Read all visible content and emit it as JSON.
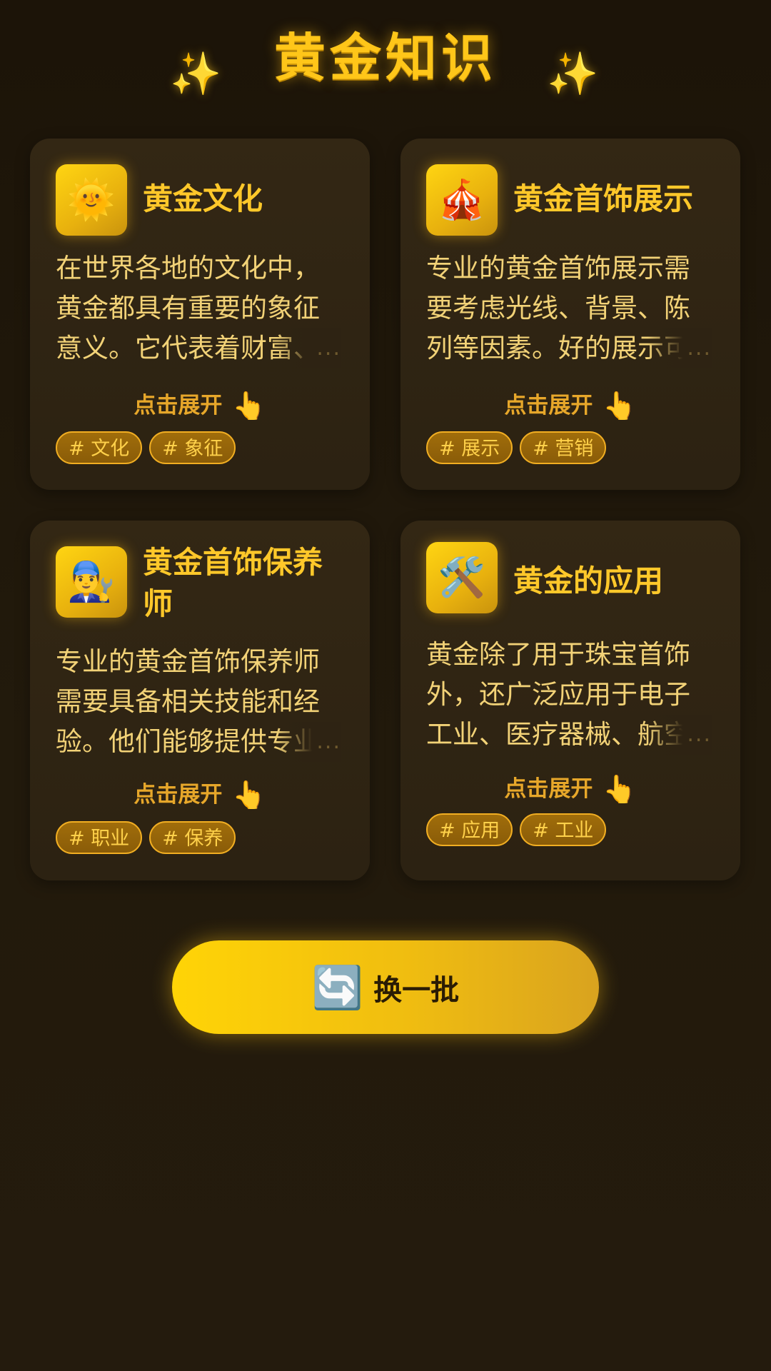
{
  "header": {
    "title": "黄金知识",
    "sparkle_left": "✨",
    "sparkle_right": "✨"
  },
  "cards": [
    {
      "icon": "🌞",
      "icon_name": "sun-face-icon",
      "title": "黄金文化",
      "text": "在世界各地的文化中，黄金都具有重要的象征意义。它代表着财富、权",
      "ellipsis": "...",
      "expand_label": "点击展开",
      "expand_icon": "👆",
      "tags": [
        "# 文化",
        "# 象征"
      ]
    },
    {
      "icon": "🎪",
      "icon_name": "circus-tent-icon",
      "title": "黄金首饰展示",
      "text": "专业的黄金首饰展示需要考虑光线、背景、陈列等因素。好的展示可以突",
      "ellipsis": "...",
      "expand_label": "点击展开",
      "expand_icon": "👆",
      "tags": [
        "# 展示",
        "# 营销"
      ]
    },
    {
      "icon": "👨‍🔧",
      "icon_name": "mechanic-icon",
      "title": "黄金首饰保养师",
      "text": "专业的黄金首饰保养师需要具备相关技能和经验。他们能够提供专业的保",
      "ellipsis": "...",
      "expand_label": "点击展开",
      "expand_icon": "👆",
      "tags": [
        "# 职业",
        "# 保养"
      ]
    },
    {
      "icon": "🛠️",
      "icon_name": "hammer-and-wrench-icon",
      "title": "黄金的应用",
      "text": "黄金除了用于珠宝首饰外，还广泛应用于电子工业、医疗器械、航空航",
      "ellipsis": "...",
      "expand_label": "点击展开",
      "expand_icon": "👆",
      "tags": [
        "# 应用",
        "# 工业"
      ]
    }
  ],
  "refresh": {
    "icon": "🔄",
    "icon_name": "refresh-icon",
    "label": "换一批"
  },
  "colors": {
    "background": "#1c1408",
    "accent": "#ffc619",
    "card": "#302413",
    "button": "#ffd406"
  }
}
